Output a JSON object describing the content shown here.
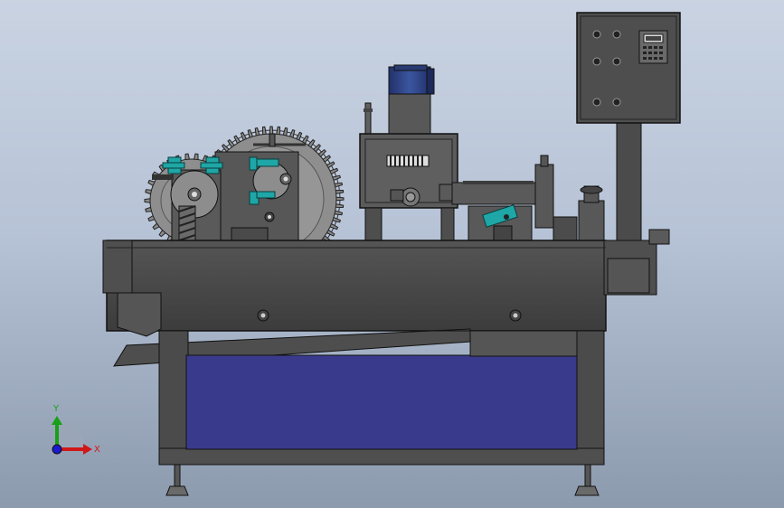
{
  "viewport": {
    "background_top": "#c9d3e2",
    "background_bottom": "#8c9aae"
  },
  "model": {
    "body_color": "#4a4a4a",
    "edge_color": "#111111",
    "panel_color": "#3a3a8c",
    "motor_color": "#2c3f7a",
    "clamp_color": "#1fa6a6"
  },
  "triad": {
    "x_label": "X",
    "y_label": "Y",
    "x_color": "#d01818",
    "y_color": "#18a018",
    "z_color": "#1a1ad0"
  },
  "control_panel": {
    "display_icon": "controller-display-icon",
    "button_icon": "round-button-icon"
  }
}
